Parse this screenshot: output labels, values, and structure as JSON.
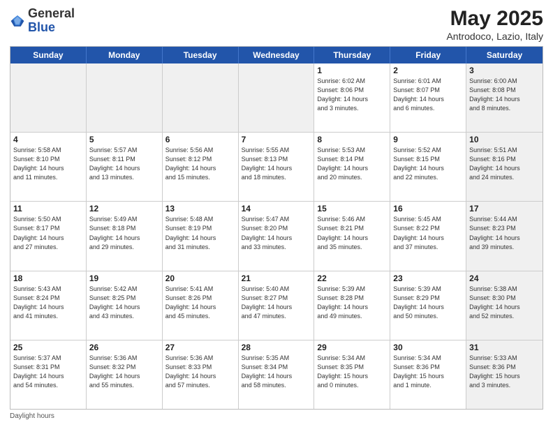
{
  "header": {
    "logo_general": "General",
    "logo_blue": "Blue",
    "title": "May 2025",
    "subtitle": "Antrodoco, Lazio, Italy"
  },
  "days": [
    "Sunday",
    "Monday",
    "Tuesday",
    "Wednesday",
    "Thursday",
    "Friday",
    "Saturday"
  ],
  "weeks": [
    [
      {
        "day": "",
        "info": "",
        "shaded": true
      },
      {
        "day": "",
        "info": "",
        "shaded": true
      },
      {
        "day": "",
        "info": "",
        "shaded": true
      },
      {
        "day": "",
        "info": "",
        "shaded": true
      },
      {
        "day": "1",
        "info": "Sunrise: 6:02 AM\nSunset: 8:06 PM\nDaylight: 14 hours\nand 3 minutes.",
        "shaded": false
      },
      {
        "day": "2",
        "info": "Sunrise: 6:01 AM\nSunset: 8:07 PM\nDaylight: 14 hours\nand 6 minutes.",
        "shaded": false
      },
      {
        "day": "3",
        "info": "Sunrise: 6:00 AM\nSunset: 8:08 PM\nDaylight: 14 hours\nand 8 minutes.",
        "shaded": true
      }
    ],
    [
      {
        "day": "4",
        "info": "Sunrise: 5:58 AM\nSunset: 8:10 PM\nDaylight: 14 hours\nand 11 minutes.",
        "shaded": false
      },
      {
        "day": "5",
        "info": "Sunrise: 5:57 AM\nSunset: 8:11 PM\nDaylight: 14 hours\nand 13 minutes.",
        "shaded": false
      },
      {
        "day": "6",
        "info": "Sunrise: 5:56 AM\nSunset: 8:12 PM\nDaylight: 14 hours\nand 15 minutes.",
        "shaded": false
      },
      {
        "day": "7",
        "info": "Sunrise: 5:55 AM\nSunset: 8:13 PM\nDaylight: 14 hours\nand 18 minutes.",
        "shaded": false
      },
      {
        "day": "8",
        "info": "Sunrise: 5:53 AM\nSunset: 8:14 PM\nDaylight: 14 hours\nand 20 minutes.",
        "shaded": false
      },
      {
        "day": "9",
        "info": "Sunrise: 5:52 AM\nSunset: 8:15 PM\nDaylight: 14 hours\nand 22 minutes.",
        "shaded": false
      },
      {
        "day": "10",
        "info": "Sunrise: 5:51 AM\nSunset: 8:16 PM\nDaylight: 14 hours\nand 24 minutes.",
        "shaded": true
      }
    ],
    [
      {
        "day": "11",
        "info": "Sunrise: 5:50 AM\nSunset: 8:17 PM\nDaylight: 14 hours\nand 27 minutes.",
        "shaded": false
      },
      {
        "day": "12",
        "info": "Sunrise: 5:49 AM\nSunset: 8:18 PM\nDaylight: 14 hours\nand 29 minutes.",
        "shaded": false
      },
      {
        "day": "13",
        "info": "Sunrise: 5:48 AM\nSunset: 8:19 PM\nDaylight: 14 hours\nand 31 minutes.",
        "shaded": false
      },
      {
        "day": "14",
        "info": "Sunrise: 5:47 AM\nSunset: 8:20 PM\nDaylight: 14 hours\nand 33 minutes.",
        "shaded": false
      },
      {
        "day": "15",
        "info": "Sunrise: 5:46 AM\nSunset: 8:21 PM\nDaylight: 14 hours\nand 35 minutes.",
        "shaded": false
      },
      {
        "day": "16",
        "info": "Sunrise: 5:45 AM\nSunset: 8:22 PM\nDaylight: 14 hours\nand 37 minutes.",
        "shaded": false
      },
      {
        "day": "17",
        "info": "Sunrise: 5:44 AM\nSunset: 8:23 PM\nDaylight: 14 hours\nand 39 minutes.",
        "shaded": true
      }
    ],
    [
      {
        "day": "18",
        "info": "Sunrise: 5:43 AM\nSunset: 8:24 PM\nDaylight: 14 hours\nand 41 minutes.",
        "shaded": false
      },
      {
        "day": "19",
        "info": "Sunrise: 5:42 AM\nSunset: 8:25 PM\nDaylight: 14 hours\nand 43 minutes.",
        "shaded": false
      },
      {
        "day": "20",
        "info": "Sunrise: 5:41 AM\nSunset: 8:26 PM\nDaylight: 14 hours\nand 45 minutes.",
        "shaded": false
      },
      {
        "day": "21",
        "info": "Sunrise: 5:40 AM\nSunset: 8:27 PM\nDaylight: 14 hours\nand 47 minutes.",
        "shaded": false
      },
      {
        "day": "22",
        "info": "Sunrise: 5:39 AM\nSunset: 8:28 PM\nDaylight: 14 hours\nand 49 minutes.",
        "shaded": false
      },
      {
        "day": "23",
        "info": "Sunrise: 5:39 AM\nSunset: 8:29 PM\nDaylight: 14 hours\nand 50 minutes.",
        "shaded": false
      },
      {
        "day": "24",
        "info": "Sunrise: 5:38 AM\nSunset: 8:30 PM\nDaylight: 14 hours\nand 52 minutes.",
        "shaded": true
      }
    ],
    [
      {
        "day": "25",
        "info": "Sunrise: 5:37 AM\nSunset: 8:31 PM\nDaylight: 14 hours\nand 54 minutes.",
        "shaded": false
      },
      {
        "day": "26",
        "info": "Sunrise: 5:36 AM\nSunset: 8:32 PM\nDaylight: 14 hours\nand 55 minutes.",
        "shaded": false
      },
      {
        "day": "27",
        "info": "Sunrise: 5:36 AM\nSunset: 8:33 PM\nDaylight: 14 hours\nand 57 minutes.",
        "shaded": false
      },
      {
        "day": "28",
        "info": "Sunrise: 5:35 AM\nSunset: 8:34 PM\nDaylight: 14 hours\nand 58 minutes.",
        "shaded": false
      },
      {
        "day": "29",
        "info": "Sunrise: 5:34 AM\nSunset: 8:35 PM\nDaylight: 15 hours\nand 0 minutes.",
        "shaded": false
      },
      {
        "day": "30",
        "info": "Sunrise: 5:34 AM\nSunset: 8:36 PM\nDaylight: 15 hours\nand 1 minute.",
        "shaded": false
      },
      {
        "day": "31",
        "info": "Sunrise: 5:33 AM\nSunset: 8:36 PM\nDaylight: 15 hours\nand 3 minutes.",
        "shaded": true
      }
    ]
  ],
  "footer": "Daylight hours"
}
